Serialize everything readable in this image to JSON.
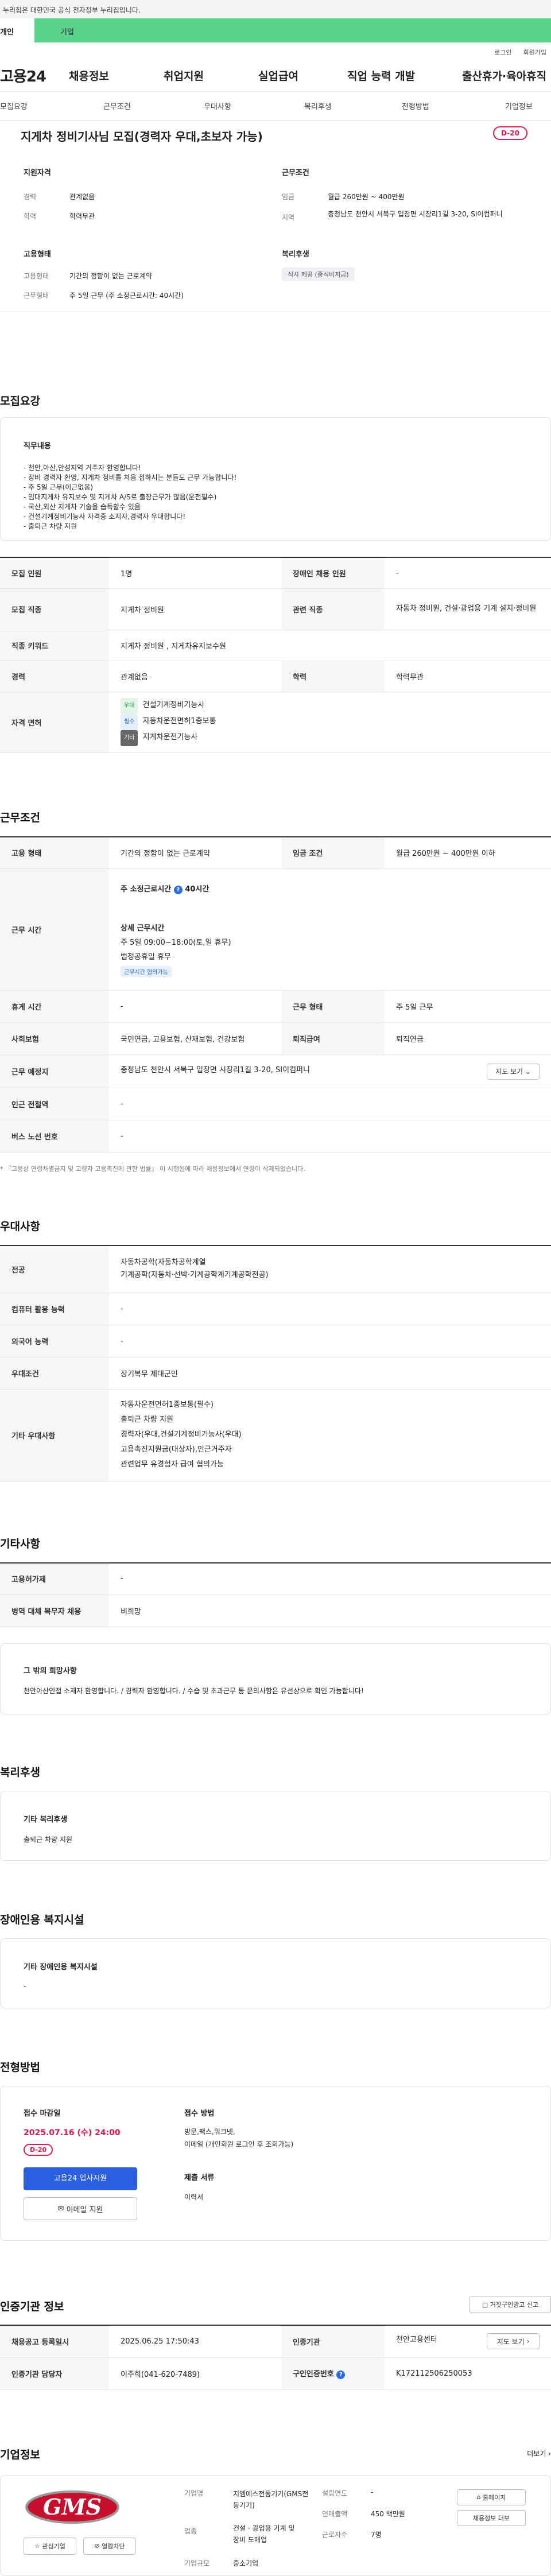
{
  "gov_banner": "이 누리집은 대한민국 공식 전자정부 누리집입니다.",
  "tabs": {
    "t1": "개인",
    "t2": "기업"
  },
  "util": {
    "login": "로그인",
    "join": "회원가입"
  },
  "gnb": {
    "logo": "고용24",
    "items": [
      "채용정보",
      "취업지원",
      "실업급여",
      "직업 능력 개발",
      "출산휴가·육아휴직"
    ]
  },
  "snb": [
    "모집요강",
    "근무조건",
    "우대사항",
    "복리후생",
    "전형방법",
    "기업정보"
  ],
  "summary": {
    "title": "지게차 정비기사님 모집(경력자 우대,초보자 가능)",
    "dday": "D-20",
    "qual_title": "지원자격",
    "career_label": "경력",
    "career_value": "관계없음",
    "edu_label": "학력",
    "edu_value": "학력무관",
    "work_title": "근무조건",
    "pay_label": "임금",
    "pay_value": "월급 260만원 ~ 400만원",
    "loc_label": "지역",
    "loc_value": "충청남도 천안시 서북구 입장면 시장리1길 3-20, SI이컴퍼니",
    "emp_title": "고용형태",
    "type_label": "고용형태",
    "type_value": "기간의 정함이 없는 근로계약",
    "hours_label": "근무형태",
    "hours_value": "주 5일 근무 (주 소정근로시간: 40시간)",
    "welfare_title": "복리후생",
    "welfare_chip": "식사 제공 (중식비지급)"
  },
  "recruit": {
    "title": "모집요강",
    "job_title": "직무내용",
    "job_lines": [
      "- 천안,아산,안성지역 거주자 환영합니다!",
      "- 장비 경력자 환영, 지게차 정비를 처음 접하시는 분들도 근무 가능합니다!",
      "- 주 5일 근무(이근없음)",
      "- 임대지게차 유지보수 및 지게차 A/S로 출장근무가 많음(운전필수)",
      "- 국산,외산 지게차 기술을 습득할수 있음",
      "- 건설기계정비기능사 자격증 소지자,경력자 우대합니다!",
      "- 출퇴근 차량 지원"
    ],
    "rows": {
      "count_label": "모집 인원",
      "count_value": "1명",
      "disabled_label": "장애인 채용 인원",
      "disabled_value": "-",
      "job_label": "모집 직종",
      "job_value": "지게차 정비원",
      "related_label": "관련 직종",
      "related_value": "자동차 정비원, 건설·광업용 기계 설치·정비원",
      "keyword_label": "직종 키워드",
      "keyword_value": "지게차 정비원 , 지게차유지보수원",
      "career_label": "경력",
      "career_value": "관계없음",
      "edu_label": "학력",
      "edu_value": "학력무관",
      "license_label": "자격 면허",
      "licenses": [
        {
          "chip": "우대",
          "name": "건설기계정비기능사"
        },
        {
          "chip": "필수",
          "name": "자동차운전면허1종보통"
        },
        {
          "chip": "기타",
          "name": "지게차운전기능사"
        }
      ]
    }
  },
  "work": {
    "title": "근무조건",
    "type_label": "고용 형태",
    "type_value": "기간의 정함이 없는 근로계약",
    "pay_label": "임금 조건",
    "pay_value": "월급 260만원 ~ 400만원 이하",
    "time_label": "근무 시간",
    "weekly": "주 소정근로시간",
    "weekly_hours": "40시간",
    "detail_title": "상세 근무시간",
    "detail_1": "주 5일 09:00~18:00(토,일 휴무)",
    "detail_2": "법정공휴일 휴무",
    "detail_chip": "근무시간 협의가능",
    "rest_label": "휴게 시간",
    "rest_value": "-",
    "form_label": "근무 형태",
    "form_value": "주 5일 근무",
    "insure_label": "사회보험",
    "insure_value": "국민연금, 고용보험, 산재보험, 건강보험",
    "retire_label": "퇴직급여",
    "retire_value": "퇴직연금",
    "place_label": "근무 예정지",
    "place_value": "충청남도 천안시 서북구 입장면 시장리1길 3-20, SI이컴퍼니",
    "map_btn": "지도 보기",
    "subway_label": "인근 전철역",
    "subway_value": "-",
    "bus_label": "버스 노선 번호",
    "bus_value": "-",
    "note": "* 『고용상 연령차별금지 및 고령자 고용촉진에 관한 법률』 이 시행됨에 따라 채용정보에서 연령이 삭제되었습니다."
  },
  "pref": {
    "title": "우대사항",
    "major_label": "전공",
    "major_lines": [
      "자동차공학(자동차공학계열",
      "기계공학(자동차·선박·기계공학계기계공학전공)"
    ],
    "pc_label": "컴퓨터 활용 능력",
    "pc_value": "-",
    "lang_label": "외국어 능력",
    "lang_value": "-",
    "cond_label": "우대조건",
    "cond_value": "장기복무 제대군인",
    "etc_label": "기타 우대사항",
    "etc_lines": [
      "자동차운전면허1종보통(필수)",
      "출퇴근 차량 지원",
      "경력자(우대,건설기계정비기능사(우대)",
      "고용촉진지원금(대상자),인근거주자",
      "관련업무 유경험자 급여 협의가능"
    ]
  },
  "other": {
    "title": "기타사항",
    "contract_label": "고용허가제",
    "contract_value": "-",
    "military_label": "병역 대체 복무자 채용",
    "military_value": "비희망",
    "hope_title": "그 밖의 희망사항",
    "hope_text": "천안아산인접 소재자 환영합니다. / 경력자 환영합니다. / 수습 및 초과근무 등 문의사항은 유선상으로 확인 가능합니다!"
  },
  "welfare": {
    "title": "복리후생",
    "sub": "기타 복리후생",
    "value": "출퇴근 차량 지원"
  },
  "disab": {
    "title": "장애인용 복지시설",
    "sub": "기타 장애인용 복지시설",
    "value": "-"
  },
  "select": {
    "title": "전형방법",
    "deadline_label": "접수 마감일",
    "deadline_value": "2025.07.16 (수) 24:00",
    "dday": "D-20",
    "apply_btn": "고용24 입사지원",
    "email_btn": "이메일 지원",
    "method_label": "접수 방법",
    "method_lines": [
      "방문,팩스,워크넷,",
      "이메일 (개인회원 로그인 후 조회가능)"
    ],
    "doc_label": "제출 서류",
    "doc_value": "이력서"
  },
  "agency": {
    "title": "인증기관 정보",
    "report_btn": "거짓구인광고 신고",
    "reg_label": "채용공고 등록일시",
    "reg_value": "2025.06.25 17:50:43",
    "org_label": "인증기관",
    "org_value": "천안고용센터",
    "map_btn": "지도 보기",
    "mgr_label": "인증기관 담당자",
    "mgr_value": "이주희(041-620-7489)",
    "num_label": "구인인증번호",
    "num_value": "K172112506250053"
  },
  "company": {
    "title": "기업정보",
    "more": "더보기",
    "logo_text": "GMS",
    "interest_btn": "관심기업",
    "block_btn": "열람차단",
    "name_label": "기업명",
    "name_value": "지엠에스전동기기(GMS전동기기)",
    "ind_label": "업종",
    "ind_value": "건설 · 광업용 기계 및 장비 도매업",
    "size_label": "기업규모",
    "size_value": "중소기업",
    "year_label": "설립연도",
    "year_value": "-",
    "sales_label": "연매출액",
    "sales_value": "450 백만원",
    "emp_label": "근로자수",
    "emp_value": "7명",
    "home_btn": "홈페이지",
    "jobs_btn": "채용정보 더보"
  }
}
